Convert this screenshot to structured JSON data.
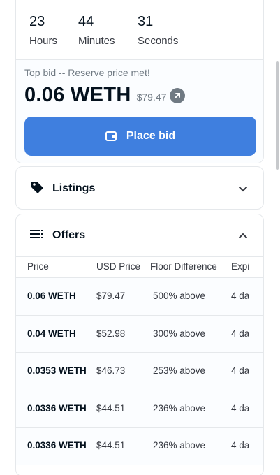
{
  "timer": {
    "hours_value": "23",
    "hours_label": "Hours",
    "minutes_value": "44",
    "minutes_label": "Minutes",
    "seconds_value": "31",
    "seconds_label": "Seconds"
  },
  "bid": {
    "status": "Top bid -- Reserve price met!",
    "price": "0.06 WETH",
    "usd": "$79.47",
    "button_label": "Place bid"
  },
  "listings": {
    "title": "Listings"
  },
  "offers": {
    "title": "Offers",
    "columns": [
      "Price",
      "USD Price",
      "Floor Difference",
      "Expi"
    ],
    "rows": [
      {
        "price": "0.06 WETH",
        "usd": "$79.47",
        "floor": "500% above",
        "exp": "4 da"
      },
      {
        "price": "0.04 WETH",
        "usd": "$52.98",
        "floor": "300% above",
        "exp": "4 da"
      },
      {
        "price": "0.0353 WETH",
        "usd": "$46.73",
        "floor": "253% above",
        "exp": "4 da"
      },
      {
        "price": "0.0336 WETH",
        "usd": "$44.51",
        "floor": "236% above",
        "exp": "4 da"
      },
      {
        "price": "0.0336 WETH",
        "usd": "$44.51",
        "floor": "236% above",
        "exp": "4 da"
      }
    ]
  },
  "icons": {
    "external": "external-link-icon",
    "wallet": "wallet-icon",
    "tag": "tag-icon",
    "list": "list-icon",
    "chevron_down": "chevron-down-icon",
    "chevron_up": "chevron-up-icon"
  },
  "colors": {
    "accent": "#3f7fdf",
    "text": "#04111d",
    "muted": "#707a83",
    "border": "#e5e8eb"
  }
}
